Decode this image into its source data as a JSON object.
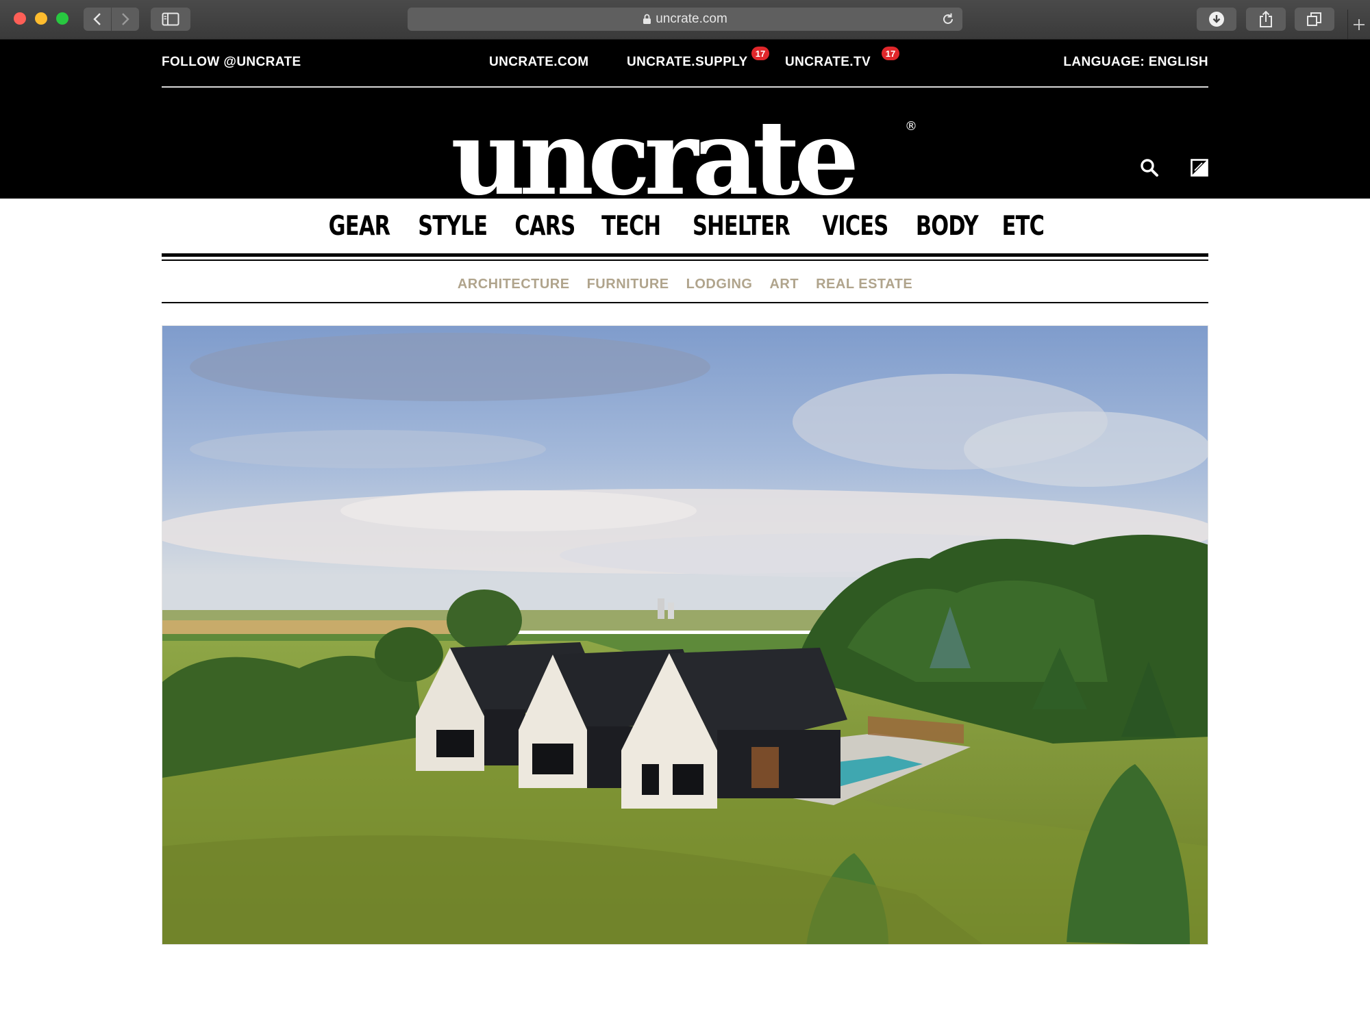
{
  "browser": {
    "url": "uncrate.com"
  },
  "topbar": {
    "follow": "FOLLOW @UNCRATE",
    "links": [
      {
        "label": "UNCRATE.COM"
      },
      {
        "label": "UNCRATE.SUPPLY",
        "badge": "17"
      },
      {
        "label": "UNCRATE.TV",
        "badge": "17"
      }
    ],
    "language": "LANGUAGE: ENGLISH"
  },
  "logo": {
    "text": "uncrate",
    "mark": "®"
  },
  "header_icons": [
    "search-icon",
    "theme-toggle-icon"
  ],
  "main_nav": [
    "GEAR",
    "STYLE",
    "CARS",
    "TECH",
    "SHELTER",
    "VICES",
    "BODY",
    "ETC"
  ],
  "sub_nav": [
    "ARCHITECTURE",
    "FURNITURE",
    "LODGING",
    "ART",
    "REAL ESTATE"
  ],
  "colors": {
    "header_bg": "#000000",
    "badge": "#e0272b",
    "sub_nav": "#b0a48c"
  }
}
